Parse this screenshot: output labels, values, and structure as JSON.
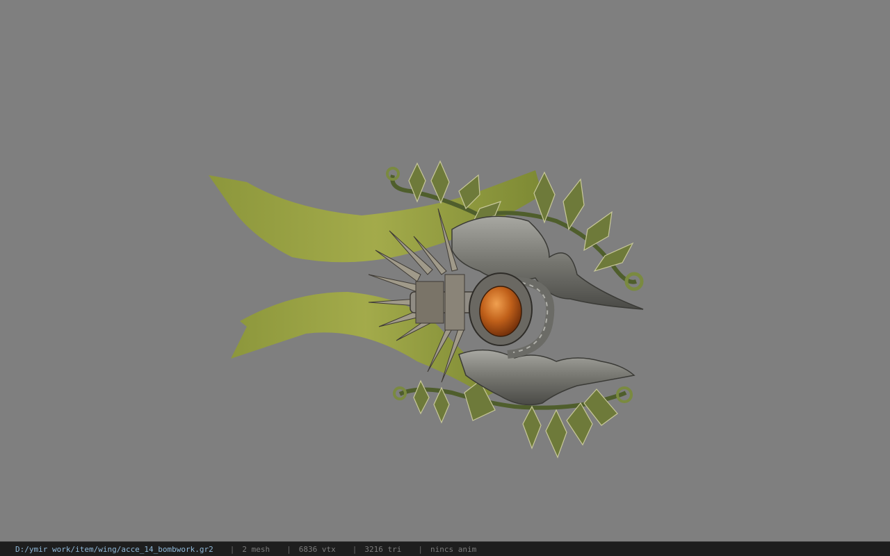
{
  "viewer": {
    "background_color": "#7f7f7f",
    "model": "wing-accessory-model"
  },
  "status_bar": {
    "file_path": "D:/ymir work/item/wing/acce_14_bombwork.gr2",
    "separator": "|",
    "mesh_count": "2 mesh",
    "vertex_count": "6836 vtx",
    "triangle_count": "3216 tri",
    "anim_status": "nincs anim"
  },
  "colors": {
    "ribbon": "#9aa43c",
    "leaf": "#6f7a3a",
    "metal": "#8a8a86",
    "gem": "#c06a20",
    "status_bg": "#1e1e1e",
    "path_text": "#8fb8d8"
  }
}
